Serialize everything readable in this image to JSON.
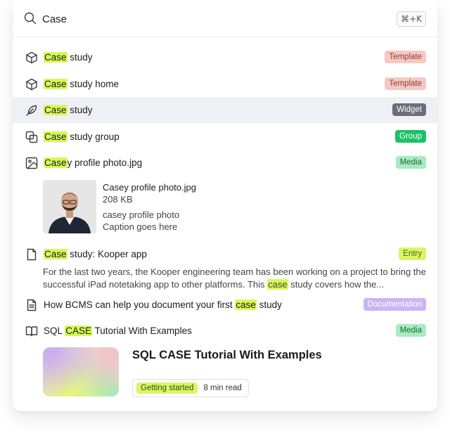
{
  "search": {
    "query": "Case",
    "shortcut": "⌘+K"
  },
  "results": [
    {
      "prefix": "",
      "highlight": "Case",
      "suffix": " study",
      "badge": "Template",
      "icon": "cube-icon"
    },
    {
      "prefix": "",
      "highlight": "Case",
      "suffix": " study home",
      "badge": "Template",
      "icon": "cube-icon"
    },
    {
      "prefix": "",
      "highlight": "Case",
      "suffix": " study",
      "badge": "Widget",
      "icon": "feather-icon",
      "active": true
    },
    {
      "prefix": "",
      "highlight": "Case",
      "suffix": " study group",
      "badge": "Group",
      "icon": "group-icon"
    },
    {
      "prefix": "",
      "highlight": "Case",
      "suffix": "y profile photo.jpg",
      "badge": "Media",
      "icon": "image-icon"
    },
    {
      "prefix": "",
      "highlight": "Case",
      "suffix": " study: Kooper app",
      "badge": "Entry",
      "icon": "document-icon"
    },
    {
      "prefix": "How BCMS can help you document your first ",
      "highlight": "case",
      "suffix": " study",
      "badge": "Documentation",
      "icon": "document-lines-icon"
    },
    {
      "prefix": "SQL ",
      "highlight": "CASE",
      "suffix": " Tutorial With Examples",
      "badge": "Media",
      "icon": "book-icon"
    }
  ],
  "media_preview": {
    "filename": "Casey profile photo.jpg",
    "size": "208 KB",
    "alt": "casey profile photo",
    "caption": "Caption goes here"
  },
  "entry_excerpt": {
    "before": "For the last two years, the Kooper engineering team has been working on a project to bring the successful iPad notetaking app to other platforms. This ",
    "highlight": "case",
    "after": " study covers how the..."
  },
  "article": {
    "title": "SQL CASE Tutorial With Examples",
    "tag": "Getting started",
    "read_time": "8 min read"
  },
  "colors": {
    "highlight": "#d6f957",
    "active_row": "#eef0f4",
    "template": "#f6c8c4",
    "widget": "#6a6f7a",
    "group": "#1fc06a",
    "media": "#a8ebc0",
    "entry": "#d9f765",
    "documentation": "#c9b5f3"
  }
}
